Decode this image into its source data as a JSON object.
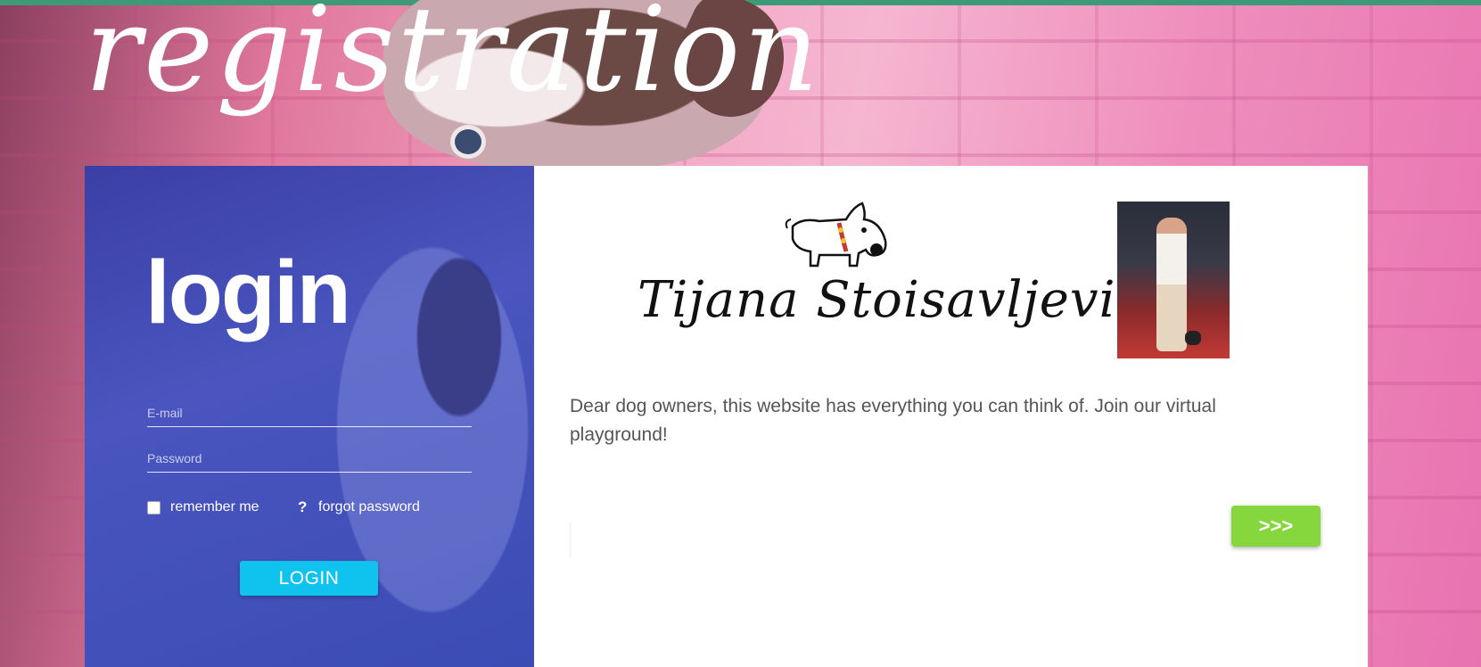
{
  "header": {
    "title": "registration"
  },
  "login": {
    "title": "login",
    "email_placeholder": "E-mail",
    "password_placeholder": "Password",
    "remember_label": "remember me",
    "forgot_label": "forgot password",
    "help_icon": "question-mark-icon",
    "button_label": "LOGIN"
  },
  "brand": {
    "name": "Tijana Stoisavljevic",
    "logo_icon": "cartoon-dog-logo"
  },
  "intro": {
    "text": "Dear dog owners, this website has everything you can think of. Join our virtual playground!"
  },
  "next_button": {
    "label": ">>>"
  },
  "colors": {
    "top_bar": "#3d9a76",
    "login_panel": "#3f4db8",
    "login_button": "#0fc3ee",
    "next_button": "#86d73e"
  }
}
